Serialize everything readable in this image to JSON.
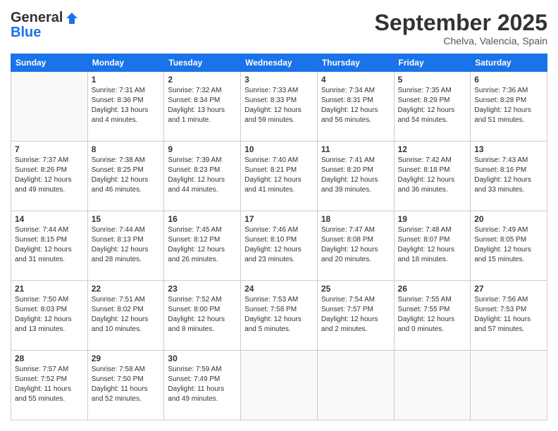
{
  "logo": {
    "line1": "General",
    "line2": "Blue"
  },
  "title": "September 2025",
  "location": "Chelva, Valencia, Spain",
  "days_of_week": [
    "Sunday",
    "Monday",
    "Tuesday",
    "Wednesday",
    "Thursday",
    "Friday",
    "Saturday"
  ],
  "weeks": [
    [
      {
        "day": "",
        "info": ""
      },
      {
        "day": "1",
        "info": "Sunrise: 7:31 AM\nSunset: 8:36 PM\nDaylight: 13 hours\nand 4 minutes."
      },
      {
        "day": "2",
        "info": "Sunrise: 7:32 AM\nSunset: 8:34 PM\nDaylight: 13 hours\nand 1 minute."
      },
      {
        "day": "3",
        "info": "Sunrise: 7:33 AM\nSunset: 8:33 PM\nDaylight: 12 hours\nand 59 minutes."
      },
      {
        "day": "4",
        "info": "Sunrise: 7:34 AM\nSunset: 8:31 PM\nDaylight: 12 hours\nand 56 minutes."
      },
      {
        "day": "5",
        "info": "Sunrise: 7:35 AM\nSunset: 8:29 PM\nDaylight: 12 hours\nand 54 minutes."
      },
      {
        "day": "6",
        "info": "Sunrise: 7:36 AM\nSunset: 8:28 PM\nDaylight: 12 hours\nand 51 minutes."
      }
    ],
    [
      {
        "day": "7",
        "info": "Sunrise: 7:37 AM\nSunset: 8:26 PM\nDaylight: 12 hours\nand 49 minutes."
      },
      {
        "day": "8",
        "info": "Sunrise: 7:38 AM\nSunset: 8:25 PM\nDaylight: 12 hours\nand 46 minutes."
      },
      {
        "day": "9",
        "info": "Sunrise: 7:39 AM\nSunset: 8:23 PM\nDaylight: 12 hours\nand 44 minutes."
      },
      {
        "day": "10",
        "info": "Sunrise: 7:40 AM\nSunset: 8:21 PM\nDaylight: 12 hours\nand 41 minutes."
      },
      {
        "day": "11",
        "info": "Sunrise: 7:41 AM\nSunset: 8:20 PM\nDaylight: 12 hours\nand 39 minutes."
      },
      {
        "day": "12",
        "info": "Sunrise: 7:42 AM\nSunset: 8:18 PM\nDaylight: 12 hours\nand 36 minutes."
      },
      {
        "day": "13",
        "info": "Sunrise: 7:43 AM\nSunset: 8:16 PM\nDaylight: 12 hours\nand 33 minutes."
      }
    ],
    [
      {
        "day": "14",
        "info": "Sunrise: 7:44 AM\nSunset: 8:15 PM\nDaylight: 12 hours\nand 31 minutes."
      },
      {
        "day": "15",
        "info": "Sunrise: 7:44 AM\nSunset: 8:13 PM\nDaylight: 12 hours\nand 28 minutes."
      },
      {
        "day": "16",
        "info": "Sunrise: 7:45 AM\nSunset: 8:12 PM\nDaylight: 12 hours\nand 26 minutes."
      },
      {
        "day": "17",
        "info": "Sunrise: 7:46 AM\nSunset: 8:10 PM\nDaylight: 12 hours\nand 23 minutes."
      },
      {
        "day": "18",
        "info": "Sunrise: 7:47 AM\nSunset: 8:08 PM\nDaylight: 12 hours\nand 20 minutes."
      },
      {
        "day": "19",
        "info": "Sunrise: 7:48 AM\nSunset: 8:07 PM\nDaylight: 12 hours\nand 18 minutes."
      },
      {
        "day": "20",
        "info": "Sunrise: 7:49 AM\nSunset: 8:05 PM\nDaylight: 12 hours\nand 15 minutes."
      }
    ],
    [
      {
        "day": "21",
        "info": "Sunrise: 7:50 AM\nSunset: 8:03 PM\nDaylight: 12 hours\nand 13 minutes."
      },
      {
        "day": "22",
        "info": "Sunrise: 7:51 AM\nSunset: 8:02 PM\nDaylight: 12 hours\nand 10 minutes."
      },
      {
        "day": "23",
        "info": "Sunrise: 7:52 AM\nSunset: 8:00 PM\nDaylight: 12 hours\nand 8 minutes."
      },
      {
        "day": "24",
        "info": "Sunrise: 7:53 AM\nSunset: 7:58 PM\nDaylight: 12 hours\nand 5 minutes."
      },
      {
        "day": "25",
        "info": "Sunrise: 7:54 AM\nSunset: 7:57 PM\nDaylight: 12 hours\nand 2 minutes."
      },
      {
        "day": "26",
        "info": "Sunrise: 7:55 AM\nSunset: 7:55 PM\nDaylight: 12 hours\nand 0 minutes."
      },
      {
        "day": "27",
        "info": "Sunrise: 7:56 AM\nSunset: 7:53 PM\nDaylight: 11 hours\nand 57 minutes."
      }
    ],
    [
      {
        "day": "28",
        "info": "Sunrise: 7:57 AM\nSunset: 7:52 PM\nDaylight: 11 hours\nand 55 minutes."
      },
      {
        "day": "29",
        "info": "Sunrise: 7:58 AM\nSunset: 7:50 PM\nDaylight: 11 hours\nand 52 minutes."
      },
      {
        "day": "30",
        "info": "Sunrise: 7:59 AM\nSunset: 7:49 PM\nDaylight: 11 hours\nand 49 minutes."
      },
      {
        "day": "",
        "info": ""
      },
      {
        "day": "",
        "info": ""
      },
      {
        "day": "",
        "info": ""
      },
      {
        "day": "",
        "info": ""
      }
    ]
  ]
}
